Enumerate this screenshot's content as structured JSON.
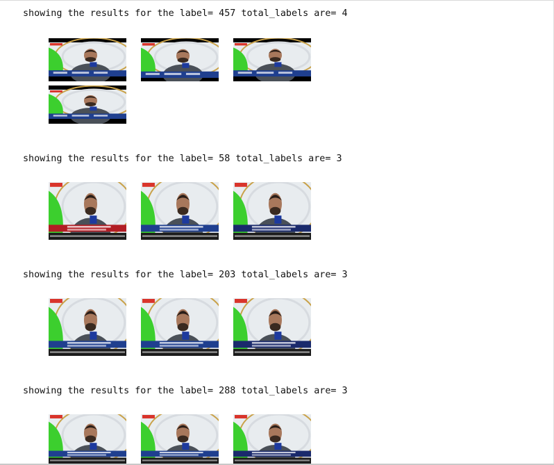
{
  "results": [
    {
      "text": "showing the results for the label= 457 total_labels are= 4",
      "label": "457",
      "total_labels": 4,
      "frames": [
        {
          "style": "letterbox"
        },
        {
          "style": "small"
        },
        {
          "style": "letterbox"
        },
        {
          "style": "letterbox"
        }
      ]
    },
    {
      "text": "showing the results for the label= 58 total_labels are= 3",
      "label": "58",
      "total_labels": 3,
      "frames": [
        {
          "style": "full",
          "lower_third": "#b21d24"
        },
        {
          "style": "full",
          "lower_third": "#1f3f8f"
        },
        {
          "style": "full",
          "lower_third": "#1a2a6c"
        }
      ]
    },
    {
      "text": "showing the results for the label= 203 total_labels are= 3",
      "label": "203",
      "total_labels": 3,
      "frames": [
        {
          "style": "full",
          "lower_third": "#1f3f8f"
        },
        {
          "style": "full",
          "lower_third": "#1f3f8f"
        },
        {
          "style": "full",
          "lower_third": "#1a2a6c"
        }
      ]
    },
    {
      "text": "showing the results for the label= 288 total_labels are= 3",
      "label": "288",
      "total_labels": 3,
      "frames": [
        {
          "style": "full",
          "lower_third": "#1f3f8f"
        },
        {
          "style": "full",
          "lower_third": "#1f3f8f"
        },
        {
          "style": "full",
          "lower_third": "#1a2a6c"
        }
      ]
    }
  ],
  "colors": {
    "text": "#111111",
    "green": "#3ccf2e",
    "backdrop": "#e8ecef",
    "shirt": "#4a5058",
    "mic_flag": "#1d3a9e"
  }
}
